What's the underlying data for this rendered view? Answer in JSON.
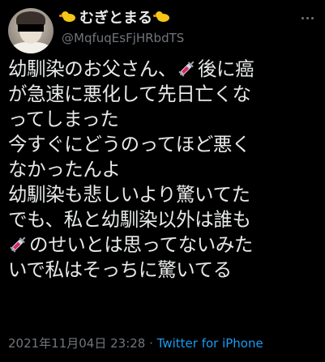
{
  "author": {
    "display_name": "むぎとまる",
    "username": "@MqfuqEsFjHRbdTS"
  },
  "tweet": {
    "lines": [
      {
        "before": "幼馴染のお父さん、",
        "emoji": "syringe",
        "after": "後に癌"
      },
      {
        "before": "が急速に悪化して先日亡くな"
      },
      {
        "before": "ってしまった"
      },
      {
        "before": "今すぐにどうのってほど悪く"
      },
      {
        "before": "なかったんよ"
      },
      {
        "before": "幼馴染も悲しいより驚いてた"
      },
      {
        "before": "でも、私と幼馴染以外は誰も"
      },
      {
        "before": "",
        "emoji": "syringe",
        "after": "のせいとは思ってないみた"
      },
      {
        "before": "いで私はそっちに驚いてる"
      }
    ]
  },
  "footer": {
    "datetime": "2021年11月04日 23:28",
    "separator": " · ",
    "source": "Twitter for iPhone"
  },
  "colors": {
    "background": "#000000",
    "text": "#e7e9ea",
    "secondary": "#71767b",
    "link": "#1d9bf0"
  },
  "icons": {
    "name_decoration": "chick-icon",
    "emoji": "syringe-icon",
    "menu": "more-icon"
  }
}
